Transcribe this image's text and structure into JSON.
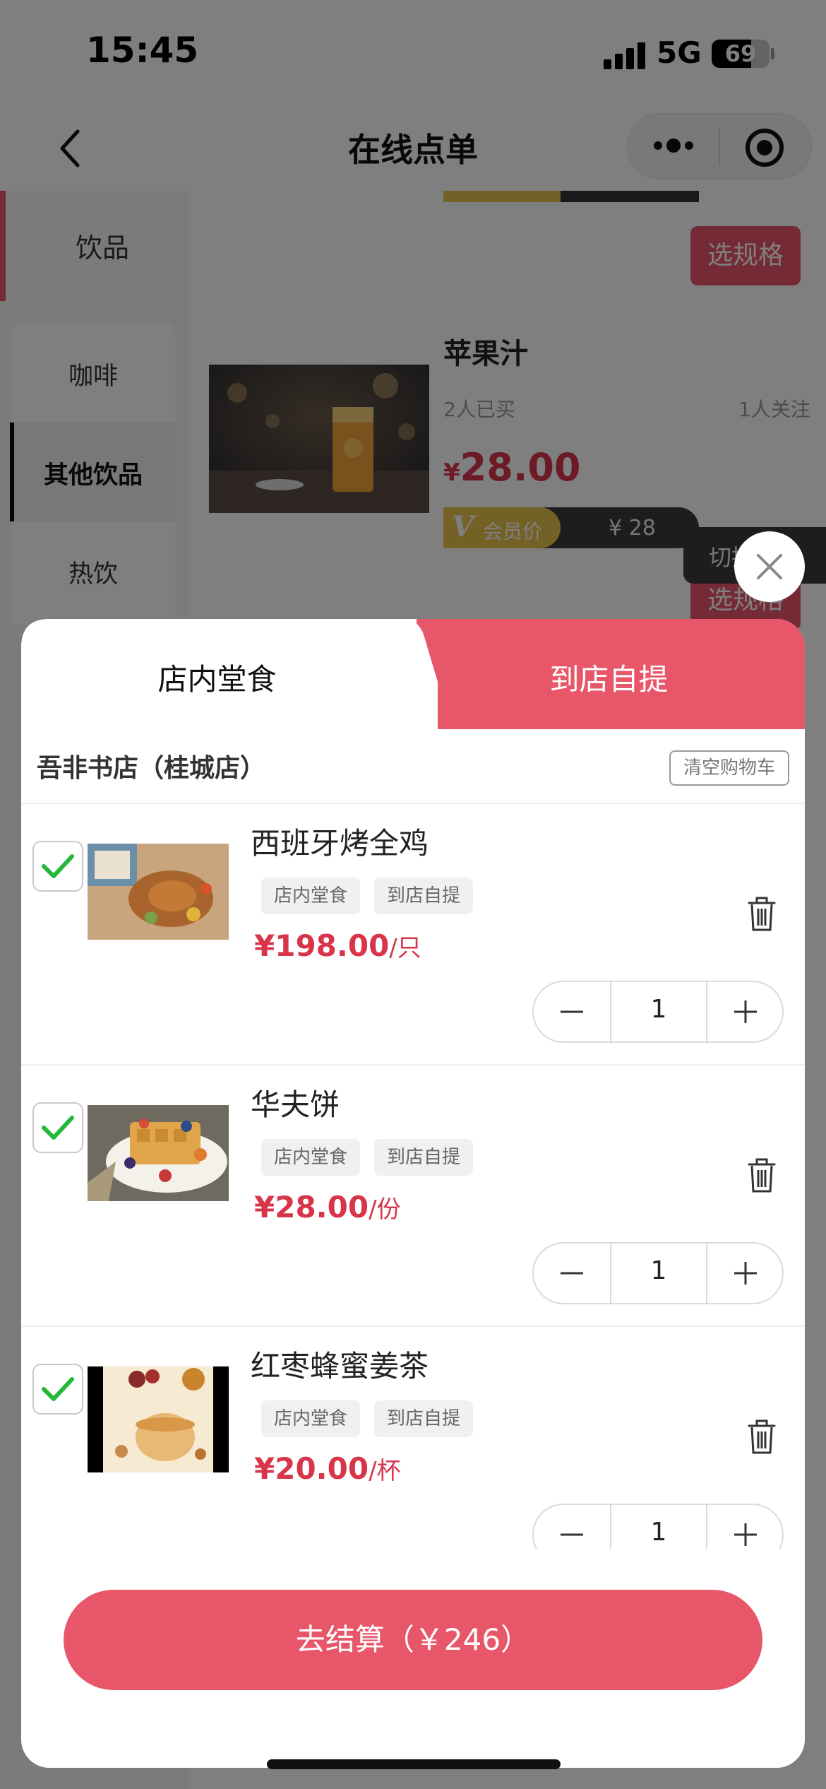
{
  "status_bar": {
    "time": "15:45",
    "network": "5G",
    "battery": "69",
    "battery_level": 0.69
  },
  "nav": {
    "title": "在线点单"
  },
  "sidebar": {
    "category": "饮品",
    "sub_items": [
      "咖啡",
      "其他饮品",
      "热饮"
    ],
    "active_sub": "其他饮品"
  },
  "product": {
    "name": "苹果汁",
    "sold": "2人已买",
    "followers": "1人关注",
    "currency": "¥",
    "price": "28.00",
    "vip_label": "会员价",
    "vip_v": "V",
    "vip_price": "¥ 28",
    "spec_button": "选规格",
    "switch_label": "切换"
  },
  "sheet": {
    "tabs": [
      "店内堂食",
      "到店自提"
    ],
    "active_tab": "到店自提",
    "store": "吾非书店（桂城店）",
    "clear_cart": "清空购物车",
    "items": [
      {
        "name": "西班牙烤全鸡",
        "tags": [
          "店内堂食",
          "到店自提"
        ],
        "price": "¥198.00",
        "unit": "/只",
        "qty": "1",
        "checked": true
      },
      {
        "name": "华夫饼",
        "tags": [
          "店内堂食",
          "到店自提"
        ],
        "price": "¥28.00",
        "unit": "/份",
        "qty": "1",
        "checked": true
      },
      {
        "name": "红枣蜂蜜姜茶",
        "tags": [
          "店内堂食",
          "到店自提"
        ],
        "price": "¥20.00",
        "unit": "/杯",
        "qty": "1",
        "checked": true
      }
    ],
    "checkout": "去结算（￥246）"
  },
  "colors": {
    "accent": "#e8566a",
    "price": "#d8354a",
    "check": "#23b83a",
    "vip_gold": "#e6c24a"
  }
}
